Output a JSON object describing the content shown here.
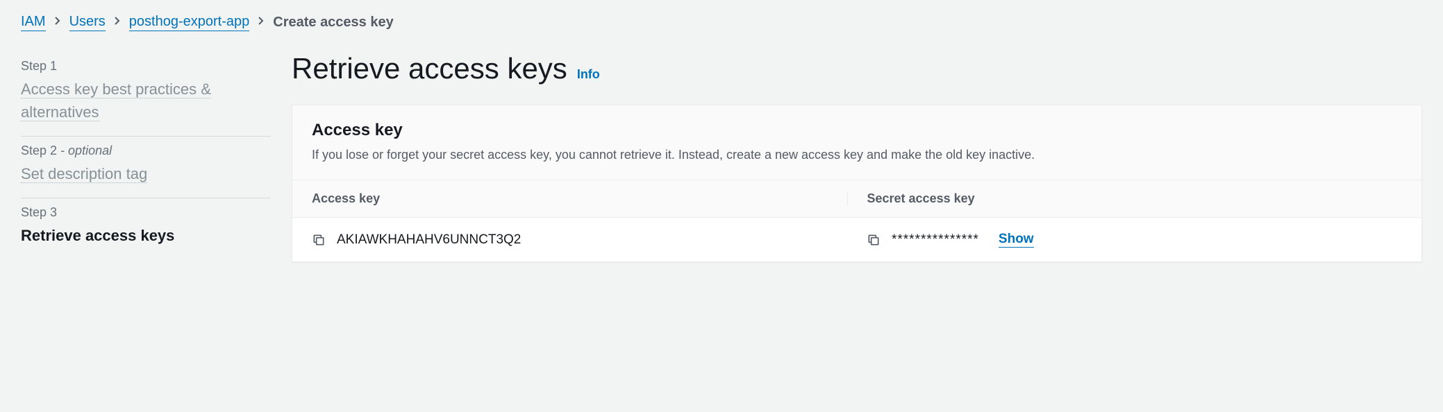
{
  "breadcrumb": {
    "items": [
      {
        "label": "IAM",
        "link": true
      },
      {
        "label": "Users",
        "link": true
      },
      {
        "label": "posthog-export-app",
        "link": true
      }
    ],
    "current": "Create access key"
  },
  "sidebar": {
    "steps": [
      {
        "label": "Step 1",
        "optional": "",
        "title": "Access key best practices & alternatives",
        "active": false
      },
      {
        "label": "Step 2",
        "optional": " - optional",
        "title": "Set description tag",
        "active": false
      },
      {
        "label": "Step 3",
        "optional": "",
        "title": "Retrieve access keys",
        "active": true
      }
    ]
  },
  "content": {
    "page_title": "Retrieve access keys",
    "info_label": "Info",
    "panel": {
      "heading": "Access key",
      "description": "If you lose or forget your secret access key, you cannot retrieve it. Instead, create a new access key and make the old key inactive.",
      "columns": {
        "access_key": "Access key",
        "secret_key": "Secret access key"
      },
      "values": {
        "access_key": "AKIAWKHAHAHV6UNNCT3Q2",
        "secret_masked": "***************",
        "show_label": "Show"
      }
    }
  }
}
